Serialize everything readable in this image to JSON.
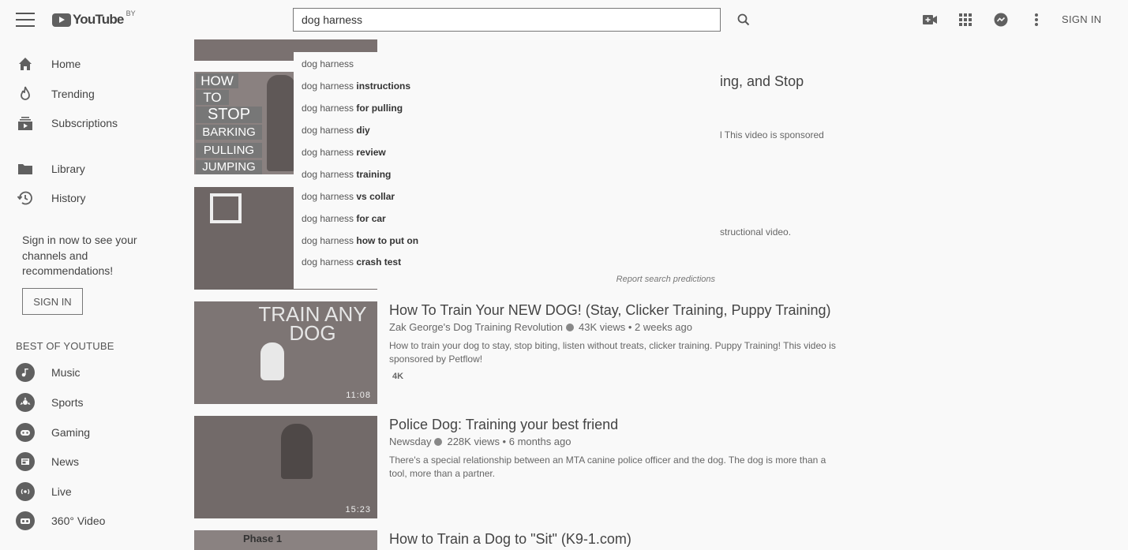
{
  "header": {
    "logo_text": "YouTube",
    "logo_region": "BY",
    "search_value": "dog harness",
    "sign_in": "SIGN IN",
    "icons": [
      "menu-icon",
      "search-icon",
      "create-video-icon",
      "apps-grid-icon",
      "messages-icon",
      "more-vertical-icon"
    ]
  },
  "sidebar": {
    "items": [
      {
        "label": "Home",
        "icon": "home-icon"
      },
      {
        "label": "Trending",
        "icon": "trending-flame-icon"
      },
      {
        "label": "Subscriptions",
        "icon": "subscriptions-icon"
      },
      {
        "label": "Library",
        "icon": "library-folder-icon"
      },
      {
        "label": "History",
        "icon": "history-clock-icon"
      }
    ],
    "signin_prompt": "Sign in now to see your channels and recommendations!",
    "signin_button": "SIGN IN",
    "best_title": "BEST OF YOUTUBE",
    "best_items": [
      {
        "label": "Music",
        "icon": "music-note-icon"
      },
      {
        "label": "Sports",
        "icon": "sports-ball-icon"
      },
      {
        "label": "Gaming",
        "icon": "gaming-controller-icon"
      },
      {
        "label": "News",
        "icon": "news-icon"
      },
      {
        "label": "Live",
        "icon": "live-broadcast-icon"
      },
      {
        "label": "360° Video",
        "icon": "vr-360-icon"
      }
    ]
  },
  "suggestions": {
    "typed": "dog harness",
    "items": [
      {
        "rest": ""
      },
      {
        "rest": " instructions"
      },
      {
        "rest": " for pulling"
      },
      {
        "rest": " diy"
      },
      {
        "rest": " review"
      },
      {
        "rest": " training"
      },
      {
        "rest": " vs collar"
      },
      {
        "rest": " for car"
      },
      {
        "rest": " how to put on"
      },
      {
        "rest": " crash test"
      }
    ],
    "report": "Report search predictions"
  },
  "partial_results": {
    "first_title_tail": "ing, and Stop",
    "first_desc_tail": "l This video is sponsored",
    "second_desc_tail": "structional video.",
    "thumb1_words": [
      "HOW",
      "TO",
      "STOP",
      "BARKING",
      "PULLING",
      "JUMPING"
    ]
  },
  "videos": [
    {
      "title": "How To Train Your NEW DOG! (Stay, Clicker Training, Puppy Training)",
      "channel": "Zak George's Dog Training Revolution",
      "stats": "43K views • 2 weeks ago",
      "desc": "How to train your dog to stay, stop biting, listen without treats, clicker training. Puppy Training! This video is sponsored by Petflow!",
      "badge": "4K",
      "duration": "11:08",
      "thumb_text": "TRAIN ANY DOG"
    },
    {
      "title": "Police Dog: Training your best friend",
      "channel": "Newsday",
      "stats": "228K views • 6 months ago",
      "desc": "There's a special relationship between an MTA canine police officer and the dog. The dog is more than a tool, more than a partner.",
      "duration": "15:23"
    },
    {
      "title": "How to Train a Dog to \"Sit\" (K9-1.com)",
      "thumb_text": "Phase 1"
    }
  ]
}
